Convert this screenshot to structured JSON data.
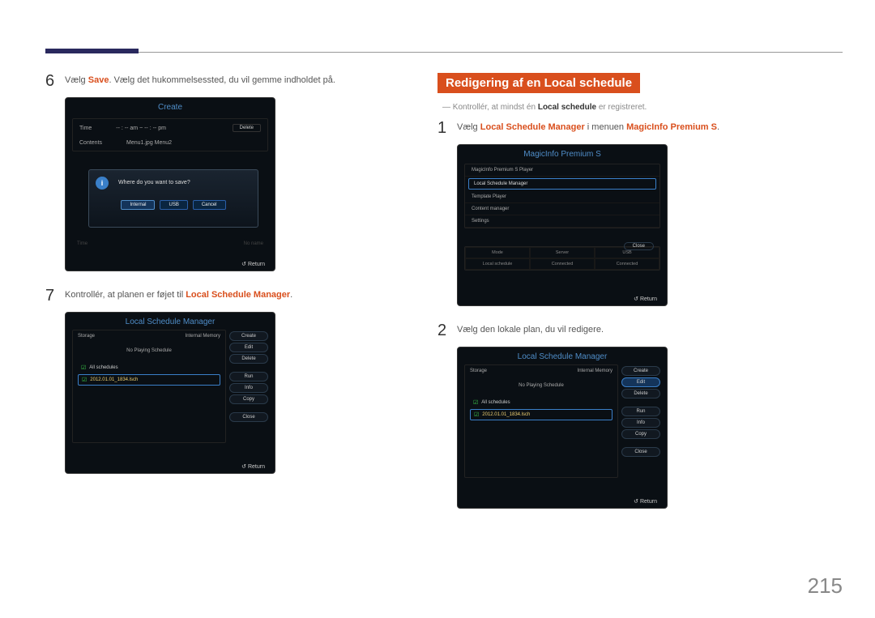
{
  "page_number": "215",
  "left": {
    "step6_num": "6",
    "step6_text_a": "Vælg ",
    "step6_text_b": "Save",
    "step6_text_c": ". Vælg det hukommelsessted, du vil gemme indholdet på.",
    "step7_num": "7",
    "step7_text_a": "Kontrollér, at planen er føjet til ",
    "step7_text_b": "Local Schedule Manager",
    "step7_text_c": "."
  },
  "right": {
    "section_title": "Redigering af en Local schedule",
    "note_a": "Kontrollér, at mindst én ",
    "note_b": "Local schedule",
    "note_c": " er registreret.",
    "step1_num": "1",
    "step1_text_a": "Vælg ",
    "step1_text_b": "Local Schedule Manager",
    "step1_text_c": " i menuen ",
    "step1_text_d": "MagicInfo Premium S",
    "step1_text_e": ".",
    "step2_num": "2",
    "step2_text": "Vælg den lokale plan, du vil redigere."
  },
  "p_create": {
    "title": "Create",
    "time_label": "Time",
    "ampm": "-- : -- am ~ -- : -- pm",
    "delete": "Delete",
    "contents_label": "Contents",
    "contents_val": "Menu1.jpg Menu2",
    "dialog_q": "Where do you want to save?",
    "btn_internal": "Internal",
    "btn_usb": "USB",
    "btn_cancel": "Cancel",
    "bot_left": "Time",
    "bot_right": "No name",
    "return": "Return"
  },
  "p_lsm": {
    "title": "Local Schedule Manager",
    "storage": "Storage",
    "internal_mem": "Internal Memory",
    "no_play": "No Playing Schedule",
    "all": "All schedules",
    "file": "2012.01.01_1834.lsch",
    "btns": [
      "Create",
      "Edit",
      "Delete",
      "Run",
      "Info",
      "Copy",
      "Close"
    ],
    "return": "Return"
  },
  "p_mi": {
    "title": "MagicInfo Premium S",
    "items": [
      "MagicInfo Premium S Player",
      "Local Schedule Manager",
      "Template Player",
      "Content manager",
      "Settings"
    ],
    "close": "Close",
    "status_h": [
      "Mode",
      "Server",
      "USB"
    ],
    "status_v": [
      "Local schedule",
      "Connected",
      "Connected"
    ],
    "return": "Return"
  },
  "p_lsm2": {
    "highlight_btn": 1
  }
}
